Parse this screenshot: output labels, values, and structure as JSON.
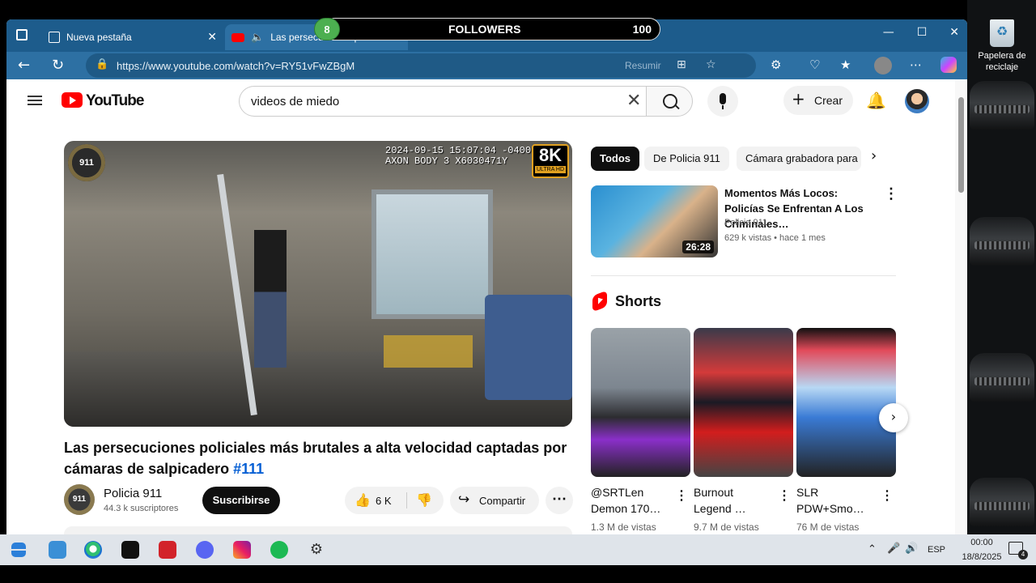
{
  "desktop": {
    "recycle_label": "Papelera de reciclaje"
  },
  "browser": {
    "tabs": [
      {
        "label": "Nueva pestaña"
      },
      {
        "label": "Las persecuciones policiales"
      }
    ],
    "url": "https://www.youtube.com/watch?v=RY51vFwZBgM",
    "resumir": "Resumir"
  },
  "overlay": {
    "badge": "8",
    "label": "FOLLOWERS",
    "value": "100"
  },
  "youtube": {
    "logo_text": "YouTube",
    "search_value": "videos de miedo",
    "create_label": "Crear",
    "video": {
      "timestamp": "2024-09-15 15:07:04 -0400",
      "camera": "AXON BODY 3 X6030471Y",
      "quality": "8K",
      "quality_sub": "ULTRA HD",
      "seal": "911",
      "title": "Las persecuciones policiales más brutales a alta velocidad captadas por cámaras de salpicadero ",
      "hashtag": "#111",
      "channel": "Policia 911",
      "subs": "44.3 k suscriptores",
      "subscribe": "Suscribirse",
      "likes": "6 K",
      "share": "Compartir"
    },
    "chips": [
      "Todos",
      "De Policia 911",
      "Cámara grabadora para"
    ],
    "recommended": {
      "title": "Momentos Más Locos: Policías Se Enfrentan A Los Criminales…",
      "channel": "Policia 911",
      "meta": "629 k vistas • hace 1 mes",
      "duration": "26:28"
    },
    "shorts_title": "Shorts",
    "shorts": [
      {
        "title": "@SRTLen Demon 170…",
        "views": "1.3 M de vistas"
      },
      {
        "title": "Burnout Legend …",
        "views": "9.7 M de vistas"
      },
      {
        "title": "SLR PDW+Smo…",
        "views": "76 M de vistas"
      }
    ]
  },
  "taskbar": {
    "lang": "ESP",
    "time": "00:00",
    "date": "18/8/2025",
    "notif": "4"
  }
}
